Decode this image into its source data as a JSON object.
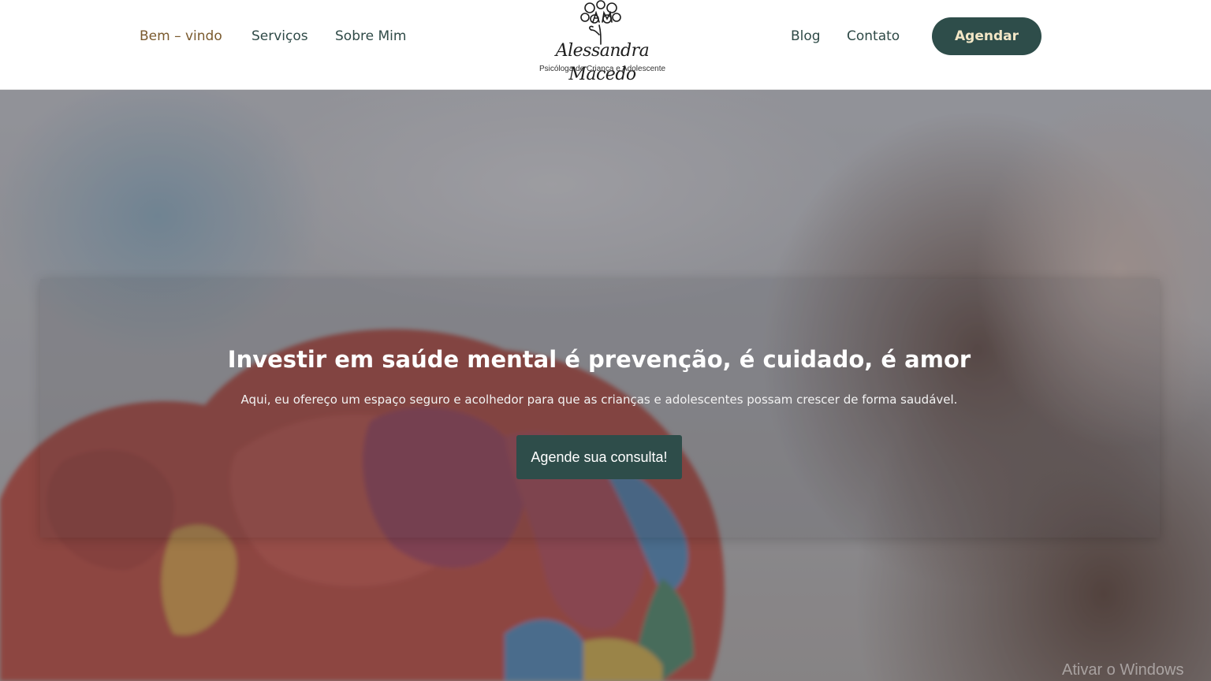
{
  "header": {
    "nav_left": [
      {
        "label": "Bem – vindo"
      },
      {
        "label": "Serviços"
      },
      {
        "label": "Sobre Mim"
      }
    ],
    "logo": {
      "name": "Alessandra Macedo",
      "subtitle": "Psicóloga de Criança e Adolescente"
    },
    "nav_right": [
      {
        "label": "Blog"
      },
      {
        "label": "Contato"
      }
    ],
    "cta_label": "Agendar"
  },
  "hero": {
    "title": "Investir em saúde mental é prevenção, é cuidado, é amor",
    "subtitle": "Aqui, eu ofereço um espaço seguro e acolhedor para que as crianças e adolescentes possam crescer de forma saudável.",
    "cta_label": "Agende sua consulta!"
  },
  "system": {
    "watermark": "Ativar o Windows"
  },
  "colors": {
    "primary": "#2e4d4a",
    "accent_text": "#f3e7c6",
    "nav_text": "#2f4a47",
    "nav_active": "#7a5a2e"
  }
}
